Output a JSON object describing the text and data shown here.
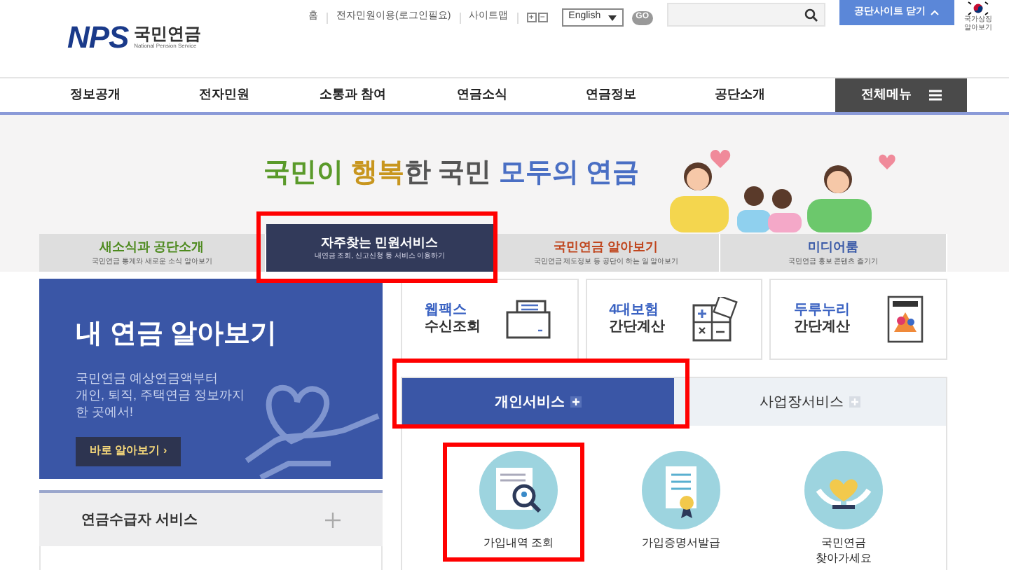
{
  "header": {
    "logo_text": "NPS",
    "logo_name": "국민연금",
    "logo_sub": "National Pension Service",
    "util_links": [
      "홈",
      "전자민원이용(로그인필요)",
      "사이트맵"
    ],
    "zoom_buttons": [
      "+",
      "−"
    ],
    "language": {
      "value": "English"
    },
    "go_button": "GO",
    "close_button": "공단사이트 닫기",
    "flag_label": "국가상징 알아보기"
  },
  "nav": {
    "items": [
      {
        "label": "정보공개",
        "selected": false
      },
      {
        "label": "전자민원",
        "selected": false
      },
      {
        "label": "소통과 참여",
        "selected": false
      },
      {
        "label": "연금소식",
        "selected": false
      },
      {
        "label": "연금정보",
        "selected": false
      },
      {
        "label": "공단소개",
        "selected": false
      }
    ],
    "all_menu": "전체메뉴"
  },
  "banner": {
    "slogan": [
      {
        "text": "국민",
        "color": "#5a9a2a"
      },
      {
        "text": "이 ",
        "color": "#5a9a2a"
      },
      {
        "text": "행복",
        "color": "#c8961e"
      },
      {
        "text": "한 국민 ",
        "color": "#555555"
      },
      {
        "text": "모두의 연금",
        "color": "#4a6fc4"
      }
    ]
  },
  "banner_tabs": [
    {
      "title": "새소식과 공단소개",
      "desc": "국민연금 통계와 새로운 소식 알아보기",
      "selected": false,
      "color": "#4d8a1e"
    },
    {
      "title": "자주찾는 민원서비스",
      "desc": "내연금 조회, 신고신청 등 서비스 이용하기",
      "selected": true,
      "color": "#ffffff"
    },
    {
      "title": "국민연금 알아보기",
      "desc": "국민연금 제도정보 등 공단이 하는 일 알아보기",
      "selected": false,
      "color": "#c0461e"
    },
    {
      "title": "미디어룸",
      "desc": "국민연금 홍보 콘텐츠 즐기기",
      "selected": false,
      "color": "#3a5aa8"
    }
  ],
  "promo": {
    "title": "내 연금 알아보기",
    "text": "국민연금 예상연금액부터\n개인, 퇴직, 주택연금 정보까지\n한 곳에서!",
    "button": "바로 알아보기 ›"
  },
  "accordion": {
    "title": "연금수급자 서비스",
    "expanded": false
  },
  "quick_cards": [
    {
      "kind": "fax",
      "line1": "웹팩스",
      "line2": "수신조회"
    },
    {
      "kind": "calc",
      "line1": "4대보험",
      "line2": "간단계산"
    },
    {
      "kind": "ledger",
      "line1": "두루누리",
      "line2": "간단계산"
    }
  ],
  "service_tabs": [
    {
      "label": "개인서비스",
      "selected": true
    },
    {
      "label": "사업장서비스",
      "selected": false
    }
  ],
  "services": [
    {
      "kind": "search",
      "label": "가입내역 조회"
    },
    {
      "kind": "certificate",
      "label": "가입증명서발급"
    },
    {
      "kind": "heart",
      "label": "국민연금\n찾아가세요"
    }
  ]
}
